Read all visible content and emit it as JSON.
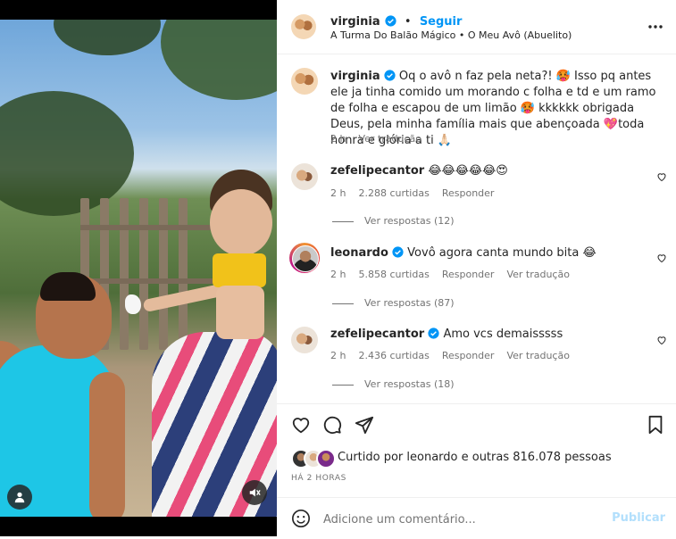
{
  "post": {
    "username": "virginia",
    "follow_label": "Seguir",
    "audio": "A Turma Do Balão Mágico • O Meu Avô (Abuelito)",
    "more_icon": "more-horizontal-icon"
  },
  "caption": {
    "username": "virginia",
    "text": "Oq o avô n faz pela neta?! 🥵 Isso pq antes ele ja tinha comido um morando c folha e td e um ramo de folha e escapou de um limão 🥵 kkkkkk obrigada Deus, pela minha família mais que abençoada 💖toda honra e glória a ti 🙏🏻",
    "time": "2 h",
    "translate": "Ver tradução"
  },
  "comments": [
    {
      "username": "zefelipecantor",
      "text": "😂😂😂😂😂😍",
      "time": "2 h",
      "likes": "2.288 curtidas",
      "reply": "Responder",
      "translate": "",
      "view_replies": "Ver respostas (12)"
    },
    {
      "username": "leonardo",
      "text": "Vovô agora canta mundo bita 😂",
      "time": "2 h",
      "likes": "5.858 curtidas",
      "reply": "Responder",
      "translate": "Ver tradução",
      "view_replies": "Ver respostas (87)"
    },
    {
      "username": "zefelipecantor",
      "text": "Amo vcs demaisssss",
      "time": "2 h",
      "likes": "2.436 curtidas",
      "reply": "Responder",
      "translate": "Ver tradução",
      "view_replies": "Ver respostas (18)"
    }
  ],
  "likes": {
    "text": "Curtido por leonardo e outras 816.078 pessoas"
  },
  "posted_time": "HÁ 2 HORAS",
  "composer": {
    "placeholder": "Adicione um comentário...",
    "publish_label": "Publicar"
  },
  "colors": {
    "accent": "#0095f6",
    "heart": "#ed4956"
  }
}
